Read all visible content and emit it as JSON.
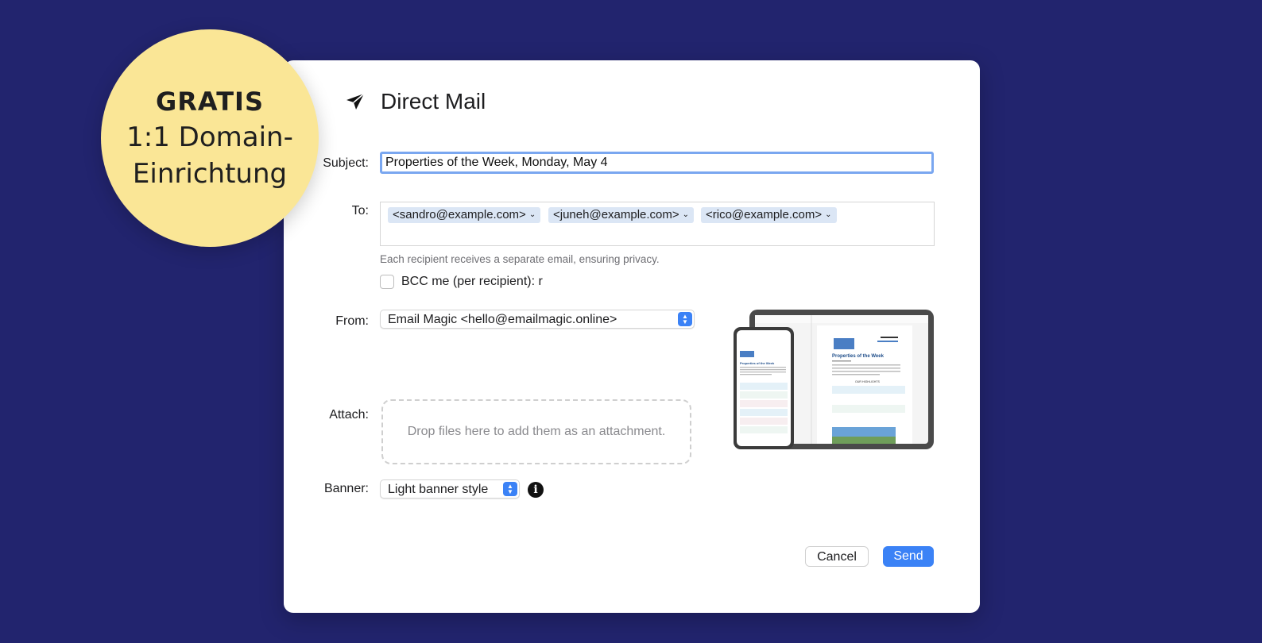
{
  "badge": {
    "line1": "GRATIS",
    "line2": "1:1 Domain-",
    "line3": "Einrichtung"
  },
  "window": {
    "title": "Direct Mail",
    "icon": "paper-plane-icon"
  },
  "form": {
    "subject_label": "Subject:",
    "subject_value": "Properties of the Week, Monday, May 4",
    "to_label": "To:",
    "recipients": [
      {
        "label": "<sandro@example.com>"
      },
      {
        "label": "<juneh@example.com>"
      },
      {
        "label": "<rico@example.com>"
      }
    ],
    "privacy_hint": "Each recipient receives a separate email, ensuring privacy.",
    "bcc_label": "BCC me (per recipient): r",
    "bcc_checked": false,
    "from_label": "From:",
    "from_value": "Email Magic <hello@emailmagic.online>",
    "attach_label": "Attach:",
    "attach_placeholder": "Drop files here to add them as an attachment.",
    "banner_label": "Banner:",
    "banner_value": "Light banner style",
    "info_icon": "info-icon"
  },
  "preview": {
    "newsletter_title": "Properties of the Week",
    "section_heading": "OUR HIGHLIGHTS"
  },
  "buttons": {
    "cancel": "Cancel",
    "send": "Send"
  },
  "colors": {
    "background": "#22246e",
    "badge": "#fae696",
    "accent": "#3b82f6"
  }
}
